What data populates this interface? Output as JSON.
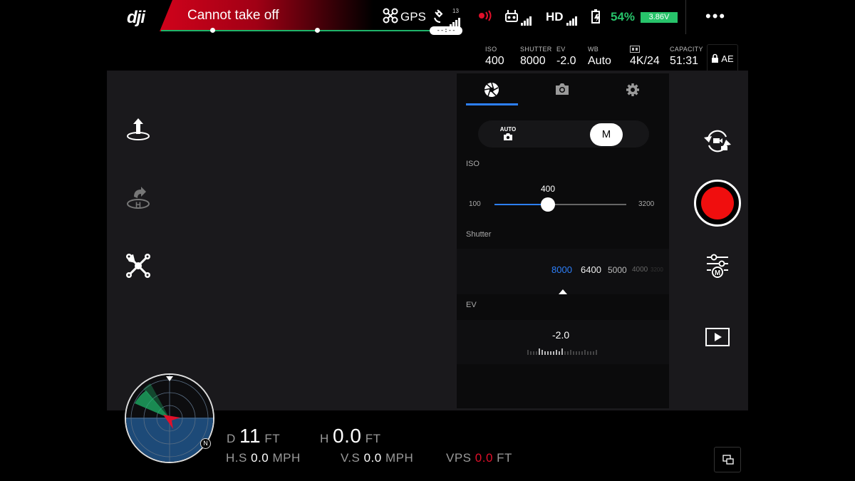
{
  "app": {
    "logo": "dji"
  },
  "status": {
    "message": "Cannot take off"
  },
  "top_bar": {
    "gps_label": "GPS",
    "satellite_count": "13",
    "gps_pill_text": "--:--",
    "hd_label": "HD",
    "battery_percent": "54%",
    "battery_voltage": "3.86V",
    "more_menu": "•••"
  },
  "camera_params": [
    {
      "label": "ISO",
      "value": "400"
    },
    {
      "label": "SHUTTER",
      "value": "8000"
    },
    {
      "label": "EV",
      "value": "-2.0"
    },
    {
      "label": "WB",
      "value": "Auto"
    },
    {
      "label": "",
      "value": "4K/24"
    },
    {
      "label": "CAPACITY",
      "value": "51:31"
    }
  ],
  "ae_lock": {
    "label": "AE"
  },
  "panel": {
    "tabs": [
      "aperture-icon",
      "camera-icon",
      "gear-icon"
    ],
    "modes": {
      "auto": "AUTO",
      "manual": "M"
    },
    "iso": {
      "label": "ISO",
      "value": "400",
      "min": "100",
      "max": "3200",
      "level": 0.4
    },
    "shutter": {
      "label": "Shutter",
      "options": [
        "8000",
        "6400",
        "5000",
        "4000",
        "3200"
      ],
      "selected": "8000"
    },
    "ev": {
      "label": "EV",
      "value": "-2.0"
    }
  },
  "telemetry": {
    "d_label": "D",
    "d_value": "11",
    "d_unit": "FT",
    "h_label": "H",
    "h_value": "0.0",
    "h_unit": "FT",
    "hs_label": "H.S",
    "hs_value": "0.0",
    "hs_unit": "MPH",
    "vs_label": "V.S",
    "vs_value": "0.0",
    "vs_unit": "MPH",
    "vps_label": "VPS",
    "vps_value": "0.0",
    "vps_unit": "FT"
  },
  "radar": {
    "north": "N"
  },
  "colors": {
    "accent": "#2d7ff9",
    "record": "#f00e0e",
    "battery": "#27c36a",
    "alert": "#d0021b"
  }
}
